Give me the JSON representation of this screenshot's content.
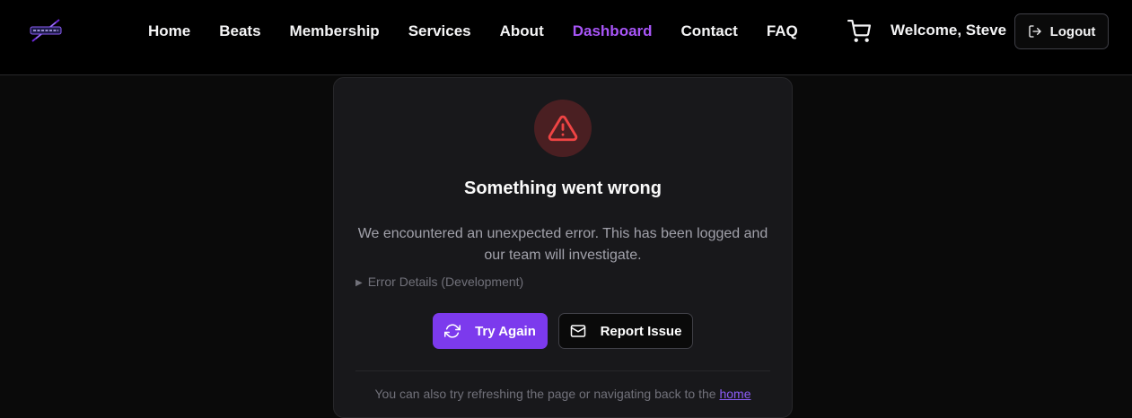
{
  "nav": {
    "links": [
      {
        "label": "Home"
      },
      {
        "label": "Beats"
      },
      {
        "label": "Membership"
      },
      {
        "label": "Services"
      },
      {
        "label": "About"
      },
      {
        "label": "Dashboard",
        "active": true
      },
      {
        "label": "Contact"
      },
      {
        "label": "FAQ"
      }
    ],
    "welcome": "Welcome, Steve",
    "logout_label": "Logout",
    "cart_icon": "shopping-cart-icon",
    "logo_icon": "brand-logo"
  },
  "error": {
    "icon": "warning-triangle-icon",
    "title": "Something went wrong",
    "message": "We encountered an unexpected error. This has been logged and our team will investigate.",
    "details_label": "Error Details (Development)",
    "try_again_label": "Try Again",
    "report_label": "Report Issue",
    "footer_text": "You can also try refreshing the page or navigating back to the",
    "footer_link": "home"
  },
  "colors": {
    "background": "#0a0a0a",
    "card": "#18181b",
    "accent": "#7c3aed",
    "active_nav": "#a855f7",
    "error_icon": "#ef4444",
    "error_bg": "#4a1f22"
  }
}
